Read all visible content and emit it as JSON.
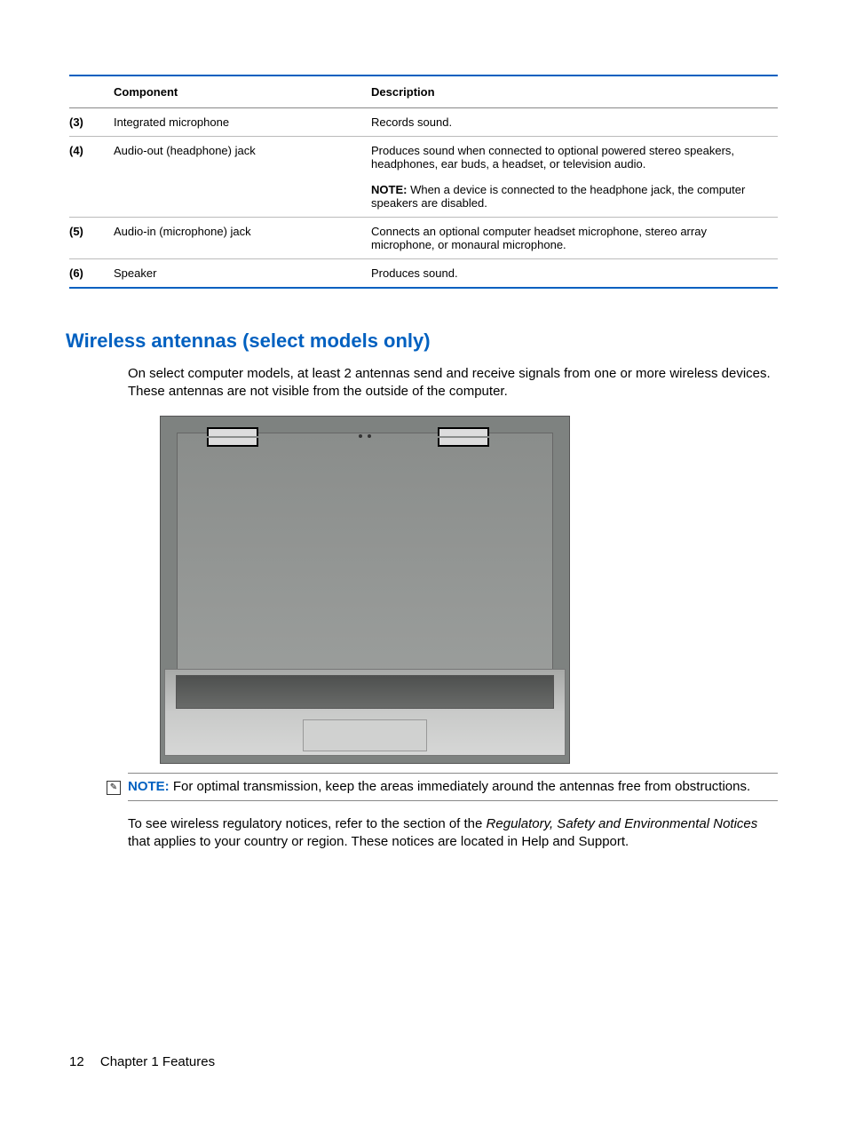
{
  "table": {
    "header_component": "Component",
    "header_description": "Description",
    "rows": [
      {
        "num": "(3)",
        "name": "Integrated microphone",
        "desc": "Records sound."
      },
      {
        "num": "(4)",
        "name": "Audio-out (headphone) jack",
        "desc": "Produces sound when connected to optional powered stereo speakers, headphones, ear buds, a headset, or television audio.",
        "note_label": "NOTE:",
        "note_text": "When a device is connected to the headphone jack, the computer speakers are disabled."
      },
      {
        "num": "(5)",
        "name": "Audio-in (microphone) jack",
        "desc": "Connects an optional computer headset microphone, stereo array microphone, or monaural microphone."
      },
      {
        "num": "(6)",
        "name": "Speaker",
        "desc": "Produces sound."
      }
    ]
  },
  "section_heading": "Wireless antennas (select models only)",
  "intro_para": "On select computer models, at least 2 antennas send and receive signals from one or more wireless devices. These antennas are not visible from the outside of the computer.",
  "note_block": {
    "label": "NOTE:",
    "text": "For optimal transmission, keep the areas immediately around the antennas free from obstructions."
  },
  "post_note": {
    "prefix": "To see wireless regulatory notices, refer to the section of the ",
    "italic": "Regulatory, Safety and Environmental Notices",
    "suffix": " that applies to your country or region. These notices are located in Help and Support."
  },
  "footer": {
    "page": "12",
    "chapter": "Chapter 1   Features"
  }
}
